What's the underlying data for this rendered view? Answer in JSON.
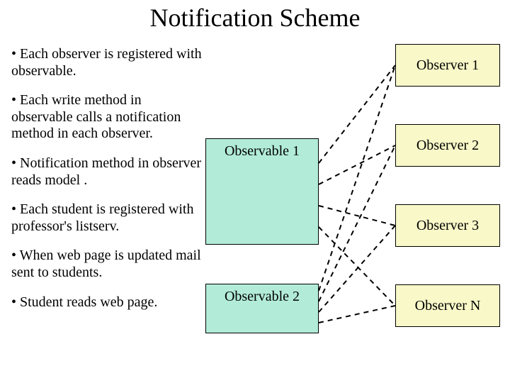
{
  "title": "Notification Scheme",
  "bullets": [
    "• Each observer is registered with observable.",
    "• Each write method in observable calls  a notification method in each observer.",
    "• Notification method in observer reads model .",
    "• Each student is registered with professor's listserv.",
    "• When web page is updated mail sent to students.",
    "• Student reads web page."
  ],
  "observables": [
    {
      "label": "Observable 1"
    },
    {
      "label": "Observable 2"
    }
  ],
  "observers": [
    {
      "label": "Observer 1"
    },
    {
      "label": "Observer 2"
    },
    {
      "label": "Observer 3"
    },
    {
      "label": "Observer N"
    }
  ]
}
